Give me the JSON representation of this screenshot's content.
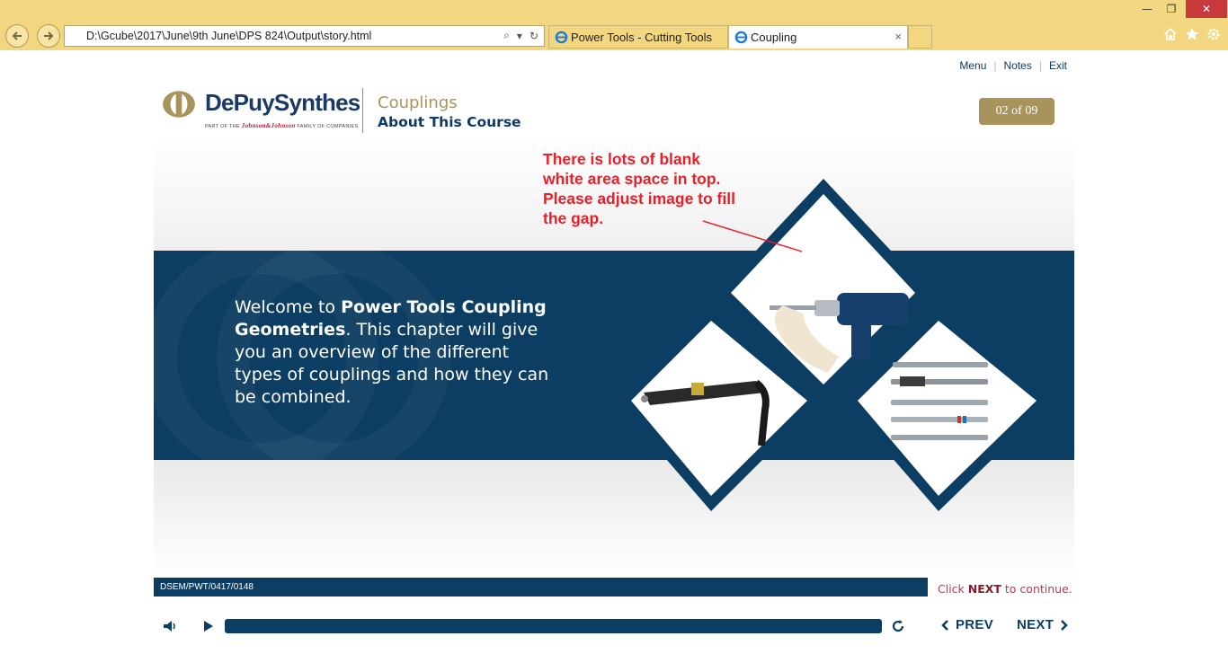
{
  "browser": {
    "address": "D:\\Gcube\\2017\\June\\9th June\\DPS 824\\Output\\story.html",
    "tabs": [
      {
        "label": "Power Tools - Cutting Tools"
      },
      {
        "label": "Coupling"
      }
    ],
    "close_glyph": "×",
    "window_controls": {
      "minimize": "—",
      "restore": "❐",
      "close": "✕"
    }
  },
  "top_links": {
    "menu": "Menu",
    "notes": "Notes",
    "exit": "Exit"
  },
  "logo": {
    "name": "DePuySynthes",
    "tagline_prefix": "PART OF THE",
    "tagline_brand": "Johnson&Johnson",
    "tagline_suffix": "FAMILY OF COMPANIES",
    "colors": {
      "mark": "#a8935c",
      "text": "#1a3a63"
    }
  },
  "course": {
    "title": "Couplings",
    "subtitle": "About This Course"
  },
  "page_counter": "02 of 09",
  "slide": {
    "welcome_prefix": "Welcome to ",
    "welcome_bold": "Power Tools Coupling Geometries",
    "welcome_rest": ". This chapter will give you an overview of the different types of couplings and how they can be combined."
  },
  "annotation": "There is lots of blank white area space in top. Please adjust image to fill the gap.",
  "footer": {
    "code": "DSEM/PWT/0417/0148",
    "click_prefix": "Click ",
    "click_next": "NEXT",
    "click_suffix": " to continue."
  },
  "player": {
    "prev_label": "PREV",
    "next_label": "NEXT",
    "icons": [
      "volume-icon",
      "play-icon",
      "replay-icon"
    ]
  },
  "colors": {
    "navy": "#0c3d62",
    "gold": "#a8935c",
    "annotation_red": "#e8202a",
    "browser_chrome": "#f2d780"
  }
}
